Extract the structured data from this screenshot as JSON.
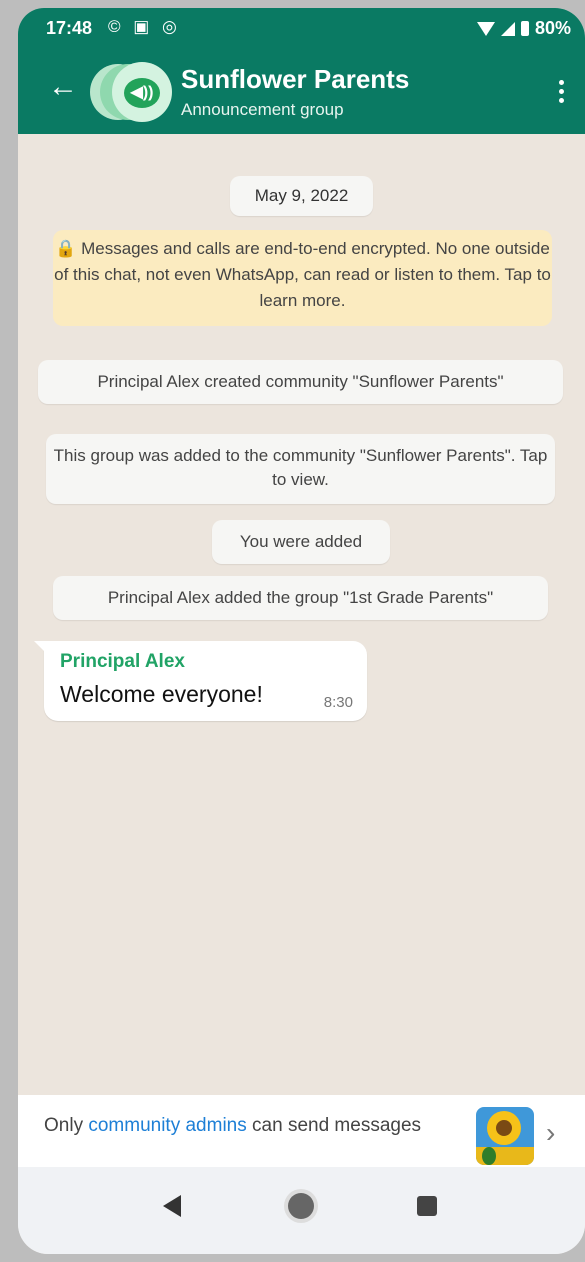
{
  "status_bar": {
    "time": "17:48",
    "notification_icons": "© ▣ ◎",
    "battery": "80%"
  },
  "header": {
    "title": "Sunflower Parents",
    "subtitle": "Announcement group",
    "accent_color": "#0a7a63"
  },
  "chat": {
    "date": "May 9, 2022",
    "encryption_notice": "🔒 Messages and calls are end-to-end encrypted. No one outside of this chat, not even WhatsApp, can read or listen to them. Tap to learn more.",
    "system_messages": [
      "Principal Alex created community \"Sunflower Parents\"",
      "This group was added to the community \"Sunflower Parents\". Tap to view.",
      "You were added",
      "Principal Alex added the group \"1st Grade Parents\""
    ],
    "message": {
      "sender": "Principal Alex",
      "text": "Welcome everyone!",
      "time": "8:30"
    }
  },
  "footer": {
    "notice_prefix": "Only ",
    "notice_link": "community admins",
    "notice_suffix": " can send messages",
    "chevron": "›"
  },
  "icons": {
    "back": "arrow-left",
    "menu": "more-vertical",
    "group": "megaphone",
    "nav": [
      "back-triangle",
      "home-circle",
      "recents-square"
    ]
  }
}
